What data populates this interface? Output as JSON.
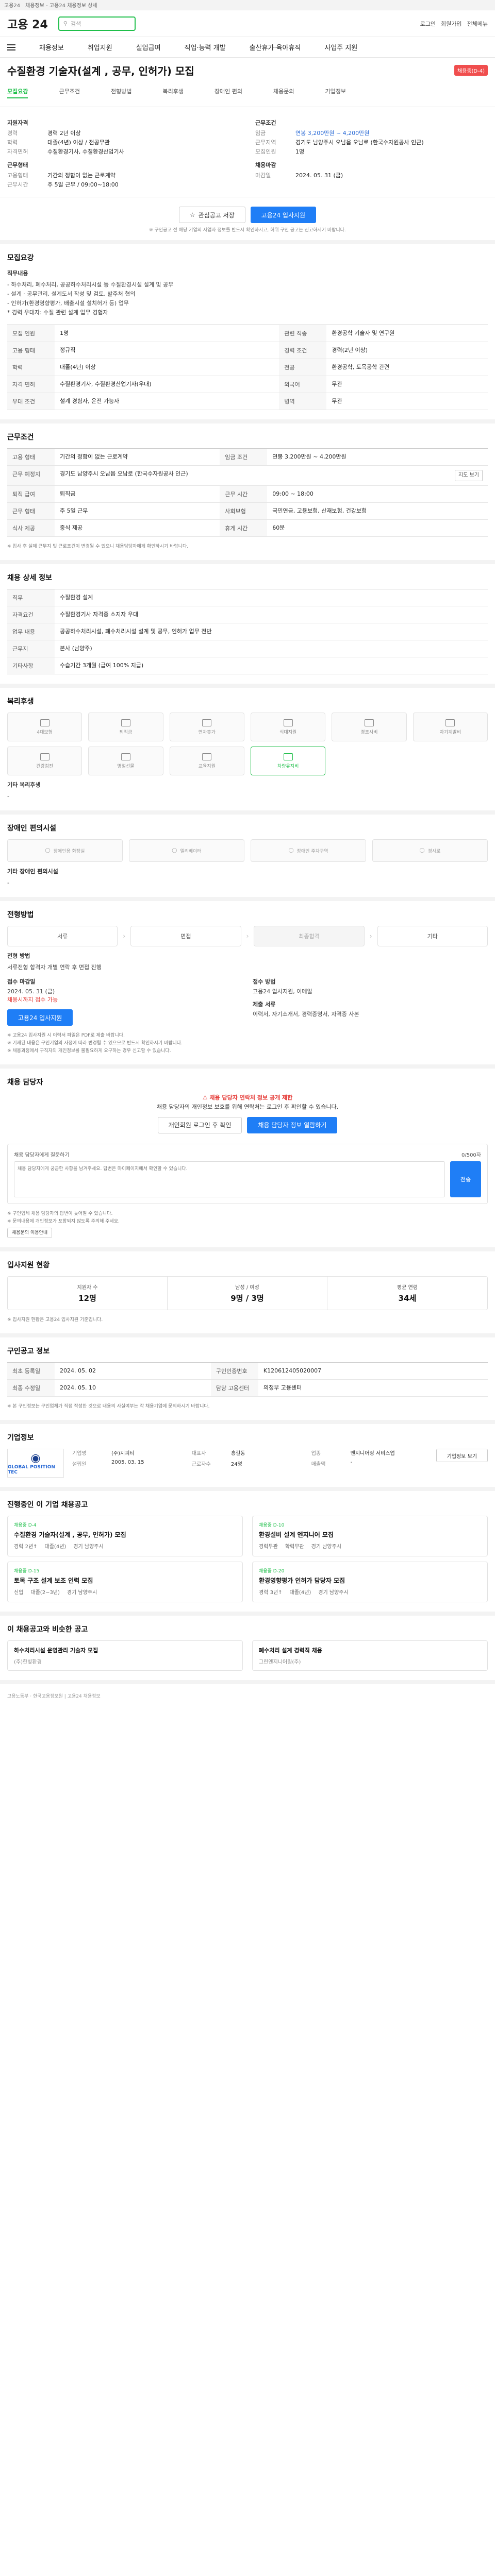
{
  "topstrip": {
    "tab1": "고용24",
    "tab2": "채용정보 - 고용24 채용정보 상세"
  },
  "header": {
    "logo": "고용 24",
    "search_placeholder": "검색",
    "links": [
      "로그인",
      "회원가입",
      "전체메뉴"
    ]
  },
  "gnb": [
    "채용정보",
    "취업지원",
    "실업급여",
    "직업·능력 개발",
    "출산휴가·육아휴직",
    "사업주 지원"
  ],
  "job": {
    "title": "수질환경 기술자(설계 , 공무, 인허가) 모집",
    "status": "채용중(D-4)",
    "sub_tabs": [
      "모집요강",
      "근무조건",
      "전형방법",
      "복리후생",
      "장애인 편의",
      "채용문의",
      "기업정보"
    ]
  },
  "summary": {
    "left_h1": "지원자격",
    "left": [
      {
        "k": "경력",
        "v": "경력 2년 이상"
      },
      {
        "k": "학력",
        "v": "대졸(4년) 이상 / 전공무관"
      },
      {
        "k": "자격면허",
        "v": "수질환경기사, 수질환경산업기사"
      }
    ],
    "left_h2": "근무형태",
    "left2": [
      {
        "k": "고용형태",
        "v": "기간의 정함이 없는 근로계약"
      },
      {
        "k": "근무시간",
        "v": "주 5일 근무 / 09:00~18:00"
      }
    ],
    "right_h1": "근무조건",
    "right": [
      {
        "k": "임금",
        "v": "연봉 3,200만원 ~ 4,200만원"
      },
      {
        "k": "근무지역",
        "v": "경기도 남양주시 오남읍 오남로 (한국수자원공사 인근)"
      },
      {
        "k": "모집인원",
        "v": "1명"
      }
    ],
    "right_h2": "채용마감",
    "right2": [
      {
        "k": "마감일",
        "v": "2024. 05. 31 (금)"
      }
    ]
  },
  "actions": {
    "scrap": "관심공고 저장",
    "apply": "고용24 입사지원"
  },
  "actions_note": "※ 구인공고 전 해당 기업의 사업자 정보를 반드시 확인하시고, 허위 구인 공고는 신고하시기 바랍니다.",
  "recruit": {
    "h": "모집요강",
    "duty_h": "직무내용",
    "duty": [
      "- 하수처리, 폐수처리, 공공하수처리시설 등 수질환경시설 설계 및 공무",
      "- 설계 · 공무관리, 설계도서 작성 및 검토, 발주처 협의",
      "- 인허가(환경영향평가, 배출시설 설치허가 등) 업무",
      "* 경력 우대자: 수질 관련 설계 업무 경험자"
    ],
    "rows": [
      {
        "k": "모집 인원",
        "v": "1명",
        "k2": "관련 직종",
        "v2": "환경공학 기술자 및 연구원"
      },
      {
        "k": "고용 형태",
        "v": "정규직",
        "k2": "경력 조건",
        "v2": "경력(2년 이상)"
      },
      {
        "k": "학력",
        "v": "대졸(4년) 이상",
        "k2": "전공",
        "v2": "환경공학, 토목공학 관련"
      },
      {
        "k": "자격 면허",
        "v": "수질환경기사, 수질환경산업기사(우대)",
        "k2": "외국어",
        "v2": "무관"
      },
      {
        "k": "우대 조건",
        "v": "설계 경험자, 운전 가능자",
        "k2": "병역",
        "v2": "무관"
      }
    ]
  },
  "workcond": {
    "h": "근무조건",
    "rows": [
      {
        "k": "고용 형태",
        "v": "기간의 정함이 없는 근로계약",
        "k2": "임금 조건",
        "v2": "연봉 3,200만원 ~ 4,200만원"
      },
      {
        "k": "근무 예정지",
        "v": "경기도 남양주시 오남읍 오남로 (한국수자원공사 인근)",
        "k2": "",
        "v2": ""
      },
      {
        "k": "퇴직 급여",
        "v": "퇴직금",
        "k2": "근무 시간",
        "v2": "09:00 ~ 18:00"
      },
      {
        "k": "근무 형태",
        "v": "주 5일 근무",
        "k2": "사회보험",
        "v2": "국민연금, 고용보험, 산재보험, 건강보험"
      },
      {
        "k": "식사 제공",
        "v": "중식 제공",
        "k2": "휴게 시간",
        "v2": "60분"
      }
    ],
    "map": "지도 보기",
    "note": "※ 입사 후 실제 근무지 및 근로조건이 변경될 수 있으니 채용담당자에게 확인하시기 바랍니다."
  },
  "detail": {
    "h": "채용 상세 정보",
    "rows": [
      {
        "k": "직무",
        "v": "수질환경 설계"
      },
      {
        "k": "자격요건",
        "v": "수질환경기사 자격증 소지자 우대"
      },
      {
        "k": "업무 내용",
        "v": "공공하수처리시설, 폐수처리시설 설계 및 공무, 인허가 업무 전반"
      },
      {
        "k": "근무지",
        "v": "본사 (남양주)"
      },
      {
        "k": "기타사항",
        "v": "수습기간 3개월 (급여 100% 지급)"
      }
    ]
  },
  "process": {
    "h": "전형방법",
    "steps": [
      "서류",
      "면접",
      "최종합격",
      "기타"
    ],
    "method_h": "전형 방법",
    "method": "서류전형 합격자 개별 연락 후 면접 진행",
    "docs_h": "제출 서류",
    "docs": "이력서, 자기소개서, 경력증명서, 자격증 사본",
    "apply_h": "접수 마감일",
    "apply_v": "2024. 05. 31 (금)",
    "apply_red": "채용시까지 접수 가능",
    "apply_way_h": "접수 방법",
    "apply_way": "고용24 입사지원, 이메일",
    "apply_btn": "고용24 입사지원"
  },
  "notes": [
    "※ 고용24 입사지원 시 이력서 파일은 PDF로 제출 바랍니다.",
    "※ 기재된 내용은 구인기업의 사정에 따라 변경될 수 있으므로 반드시 확인하시기 바랍니다.",
    "※ 채용과정에서 구직자의 개인정보를 불필요하게 요구하는 경우 신고할 수 있습니다."
  ],
  "welfare": {
    "h": "복리후생",
    "items": [
      {
        "name": "4대보험",
        "on": false
      },
      {
        "name": "퇴직금",
        "on": false
      },
      {
        "name": "연차휴가",
        "on": false
      },
      {
        "name": "식대지원",
        "on": false
      },
      {
        "name": "경조사비",
        "on": false
      },
      {
        "name": "자기계발비",
        "on": false
      },
      {
        "name": "건강검진",
        "on": false
      },
      {
        "name": "명절선물",
        "on": false
      },
      {
        "name": "교육지원",
        "on": false
      },
      {
        "name": "차량유지비",
        "on": true
      }
    ],
    "etc_h": "기타 복리후생",
    "etc": "-"
  },
  "disability": {
    "h": "장애인 편의시설",
    "items": [
      "장애인용 화장실",
      "엘리베이터",
      "장애인 주차구역",
      "경사로"
    ],
    "etc_h": "기타 장애인 편의시설",
    "etc": "-"
  },
  "inquiry": {
    "h": "채용 담당자",
    "warn_title": "채용 담당자 연락처 정보 공개 제한",
    "warn_body": "채용 담당자의 개인정보 보호를 위해 연락처는 로그인 후 확인할 수 있습니다.",
    "btn_login": "개인회원 로그인 후 확인",
    "btn_view": "채용 담당자 정보 열람하기",
    "box_head": "채용 담당자에게 질문하기",
    "box_count": "0/500자",
    "placeholder": "채용 담당자에게 궁금한 사항을 남겨주세요. 답변은 마이페이지에서 확인할 수 있습니다.",
    "send": "전송",
    "notes": [
      "※ 구인업체 채용 담당자의 답변이 늦어질 수 있습니다.",
      "※ 문의내용에 개인정보가 포함되지 않도록 주의해 주세요."
    ],
    "notes_btn": "채용문의 이용안내"
  },
  "stats": {
    "h": "입사지원 현황",
    "cells": [
      {
        "l": "지원자 수",
        "v": "12명"
      },
      {
        "l": "남성 / 여성",
        "v": "9명 / 3명"
      },
      {
        "l": "평균 연령",
        "v": "34세"
      }
    ],
    "note": "※ 입사지원 현황은 고용24 입사지원 기준입니다."
  },
  "registry": {
    "h": "구인공고 정보",
    "rows": [
      {
        "k": "최초 등록일",
        "v": "2024. 05. 02",
        "k2": "구인인증번호",
        "v2": "K120612405020007"
      },
      {
        "k": "최종 수정일",
        "v": "2024. 05. 10",
        "k2": "담당 고용센터",
        "v2": "의정부 고용센터"
      }
    ],
    "note": "※ 본 구인정보는 구인업체가 직접 작성한 것으로 내용의 사실여부는 각 채용기업에 문의하시기 바랍니다."
  },
  "company": {
    "h": "기업정보",
    "logo_text": "GLOBAL POSITION TEC",
    "rows": [
      {
        "k": "기업명",
        "v": "(주)지피티"
      },
      {
        "k": "대표자",
        "v": "홍길동"
      },
      {
        "k": "업종",
        "v": "엔지니어링 서비스업"
      },
      {
        "k": "설립일",
        "v": "2005. 03. 15"
      },
      {
        "k": "근로자수",
        "v": "24명"
      },
      {
        "k": "매출액",
        "v": "-"
      }
    ],
    "btn": "기업정보 보기"
  },
  "other_jobs": {
    "h": "진행중인 이 기업 채용공고",
    "items": [
      {
        "tag": "채용중 D-4",
        "name": "수질환경 기술자(설계 , 공무, 인허가) 모집",
        "career": "경력 2년↑",
        "edu": "대졸(4년)",
        "loc": "경기 남양주시"
      },
      {
        "tag": "채용중 D-10",
        "name": "환경설비 설계 엔지니어 모집",
        "career": "경력무관",
        "edu": "학력무관",
        "loc": "경기 남양주시"
      },
      {
        "tag": "채용중 D-15",
        "name": "토목 구조 설계 보조 인력 모집",
        "career": "신입",
        "edu": "대졸(2~3년)",
        "loc": "경기 남양주시"
      },
      {
        "tag": "채용중 D-20",
        "name": "환경영향평가 인허가 담당자 모집",
        "career": "경력 3년↑",
        "edu": "대졸(4년)",
        "loc": "경기 남양주시"
      }
    ]
  },
  "recommend": {
    "h": "이 채용공고와 비슷한 공고",
    "items": [
      {
        "name": "하수처리시설 운영관리 기술자 모집",
        "co": "(주)한빛환경"
      },
      {
        "name": "폐수처리 설계 경력직 채용",
        "co": "그린엔지니어링(주)"
      }
    ]
  },
  "footer": "고용노동부 · 한국고용정보원 | 고용24 채용정보"
}
